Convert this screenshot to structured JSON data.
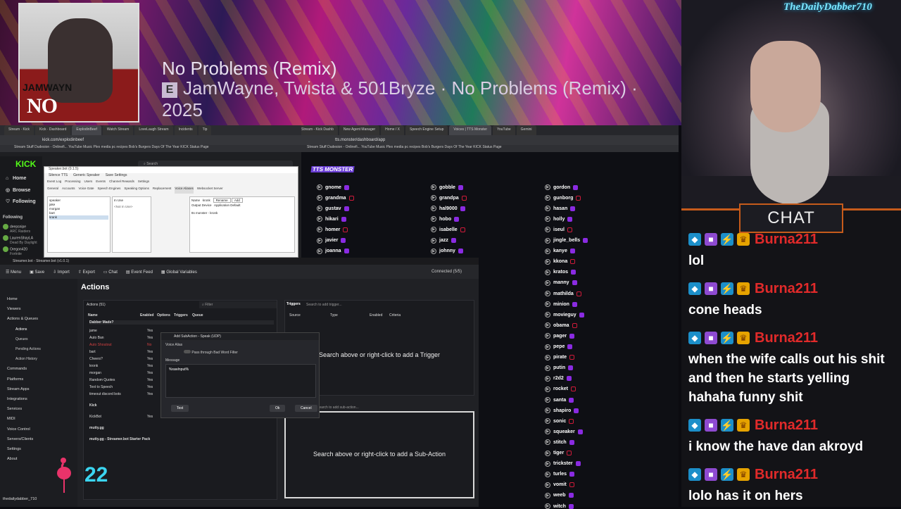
{
  "now_playing": {
    "title": "No Problems (Remix)",
    "artist_line": "JamWayne, Twista & 501Bryze · No Problems (Remix) · 2025",
    "explicit_mark": "E",
    "cover_artist": "JAMWAYN",
    "cover_title": "NO PROBLEMS"
  },
  "overlay": {
    "streamer_logo": "TheDailyDabber710",
    "corner_number": "22"
  },
  "chat": {
    "header": "CHAT",
    "messages": [
      {
        "user": "Burna211",
        "text": "lol"
      },
      {
        "user": "Burna211",
        "text": "cone heads"
      },
      {
        "user": "Burna211",
        "text": "when the wife calls out his shit and then he starts yelling hahaha funny shit"
      },
      {
        "user": "Burna211",
        "text": "i know the have dan akroyd"
      },
      {
        "user": "Burna211",
        "text": "lolo has it on hers"
      }
    ]
  },
  "left_browser": {
    "tabs": [
      "Stream · Kick",
      "Kick · Dashboard",
      "ExplodinBeef",
      "Watch Stream",
      "LoveLaugh Stream",
      "Incidents",
      "Tip"
    ],
    "url": "kick.com/explodinbeef",
    "bookmarks": "Stream Stuff   Dudesion - Onlinefi...   YouTube Music   Plex   media pc   recipes   Bob's Burgers   Days Of The Year   KICK Status Page",
    "kick": {
      "logo": "KICK",
      "nav": [
        "Home",
        "Browse",
        "Following"
      ],
      "following_label": "Following",
      "follows": [
        {
          "name": "deepsnipe",
          "sub": "ARC Raiders"
        },
        {
          "name": "LaurenShayLA",
          "sub": "Dead By Daylight"
        },
        {
          "name": "Oregon420",
          "sub": "Fortnite"
        }
      ],
      "search_placeholder": "Search"
    }
  },
  "speakerbot": {
    "title": "Speaker.bot (0.1.5)",
    "menu": [
      "Silence TTS",
      "Generic Speaker",
      "Save Settings"
    ],
    "tabs": [
      "Event Log",
      "Processing",
      "Users",
      "Events",
      "Channel Rewards",
      "Settings"
    ],
    "subtabs": [
      "General",
      "Accounts",
      "Voice Gate",
      "Speech Engines",
      "Speaking Options",
      "Replacement",
      "Voice Aliases",
      "Websocket Server"
    ],
    "aliases": [
      "speaker",
      "jake",
      "morgan",
      "bart",
      "krank"
    ],
    "in_use_label": "In Use",
    "in_use_value": "<Not In Use>",
    "name_label": "Name",
    "name_value": "kronk",
    "output_device": "Output Device",
    "output_value": "Application Default",
    "engine_voice": "tts monster - kronk",
    "buttons": [
      "Rename",
      "Add"
    ]
  },
  "streamerbot": {
    "title": "Streamer.bot - Streamer.bot (v1.0.1)",
    "toolbar": [
      "Menu",
      "Save",
      "Import",
      "Export",
      "Chat",
      "Event Feed",
      "Global Variables"
    ],
    "connection": "Connected (5/5)",
    "sidebar": [
      "Home",
      "Viewers",
      "Actions & Queues",
      "Actions",
      "Queues",
      "Pending Actions",
      "Action History",
      "Commands",
      "Platforms",
      "Stream Apps",
      "Integrations",
      "Services",
      "MIDI",
      "Voice Control",
      "Servers/Clients",
      "Settings",
      "About"
    ],
    "user": "thedailydabber_710",
    "page_title": "Actions",
    "actions_count": "Actions (51)",
    "filter_placeholder": "Filter",
    "columns": [
      "Name",
      "Enabled",
      "Options",
      "Triggers",
      "Queue"
    ],
    "groups": [
      "Dabber Made?",
      "Kick",
      "mutty.gg",
      "mutty.gg - Streamer.bot Starter Pack"
    ],
    "rows": [
      {
        "name": "jame",
        "enabled": "Yes"
      },
      {
        "name": "Auto Ban",
        "enabled": "Yes"
      },
      {
        "name": "Auto Shoutout",
        "enabled": "No"
      },
      {
        "name": "bart",
        "enabled": "Yes"
      },
      {
        "name": "Cheers?",
        "enabled": "Yes"
      },
      {
        "name": "kronk",
        "enabled": "Yes"
      },
      {
        "name": "morgan",
        "enabled": "Yes"
      },
      {
        "name": "Random Quotes",
        "enabled": "Yes"
      },
      {
        "name": "Text to Speech",
        "enabled": "Yes"
      },
      {
        "name": "timeout discord bots",
        "enabled": "Yes"
      },
      {
        "name": "KickBot",
        "enabled": "Yes"
      }
    ],
    "triggers_label": "Triggers",
    "trigger_search_placeholder": "Search to add trigger...",
    "trigger_columns": [
      "Source",
      "Type",
      "Enabled",
      "Criteria"
    ],
    "trigger_hint": "Search above or right-click to add a Trigger",
    "subaction_search_placeholder": "Search to add sub-action...",
    "subaction_hint": "Search above or right-click to add a Sub-Action",
    "dialog": {
      "title": "Add SubAction - Speak (UDP)",
      "voice_alias_label": "Voice Alias",
      "bad_word_label": "Pass through Bad Word Filter",
      "message_label": "Message",
      "message_value": "%rawInput%",
      "test": "Test",
      "ok": "Ok",
      "cancel": "Cancel"
    }
  },
  "right_browser": {
    "tabs": [
      "Stream - Kick Dashb",
      "New Agent Manager",
      "Home / X",
      "Speech Engine Setup",
      "Voices | TTS Monster",
      "YouTube",
      "Gemini"
    ],
    "url": "tts.monster/dashboard/app",
    "logo": "TTS MONSTER",
    "voices_col1": [
      "gnome",
      "grandma",
      "gustav",
      "hikari",
      "homer",
      "javier",
      "joanna"
    ],
    "voices_col2": [
      "gobble",
      "grandpa",
      "hal9000",
      "hobo",
      "isabelle",
      "jazz",
      "johnny"
    ],
    "voices_col3": [
      "gordon",
      "gunborg",
      "hasan",
      "holly",
      "iseul",
      "jingle_bells",
      "kanye",
      "kkona",
      "kratos",
      "manny",
      "mathilda",
      "minion",
      "movieguy",
      "obama",
      "pager",
      "pepe",
      "pirate",
      "putin",
      "r2d2",
      "rocket",
      "santa",
      "shapiro",
      "sonic",
      "squeaker",
      "stitch",
      "tiger",
      "trickster",
      "turles",
      "vomit",
      "weeb",
      "witch"
    ]
  },
  "colors": {
    "accent": "#53fc18",
    "chat_user": "#e12a2a",
    "tts_purple": "#8a2be2",
    "chat_border": "#c65b1b"
  }
}
